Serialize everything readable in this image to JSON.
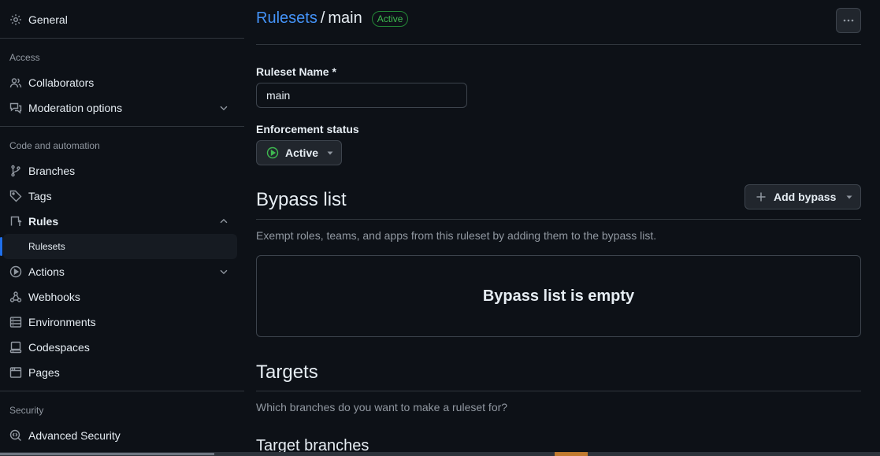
{
  "sidebar": {
    "general": "General",
    "access_label": "Access",
    "collaborators": "Collaborators",
    "moderation": "Moderation options",
    "code_label": "Code and automation",
    "branches": "Branches",
    "tags": "Tags",
    "rules": "Rules",
    "rulesets": "Rulesets",
    "actions": "Actions",
    "webhooks": "Webhooks",
    "environments": "Environments",
    "codespaces": "Codespaces",
    "pages": "Pages",
    "security_label": "Security",
    "advanced_security": "Advanced Security"
  },
  "header": {
    "breadcrumb_link": "Rulesets",
    "separator": "/",
    "current": "main",
    "status_badge": "Active"
  },
  "form": {
    "name_label": "Ruleset Name *",
    "name_value": "main",
    "enforcement_label": "Enforcement status",
    "enforcement_value": "Active"
  },
  "bypass": {
    "heading": "Bypass list",
    "add_button": "Add bypass",
    "description": "Exempt roles, teams, and apps from this ruleset by adding them to the bypass list.",
    "empty": "Bypass list is empty"
  },
  "targets": {
    "heading": "Targets",
    "description": "Which branches do you want to make a ruleset for?",
    "subheading": "Target branches"
  },
  "colors": {
    "background": "#0d1117",
    "link": "#4493f8",
    "success": "#3fb950",
    "border": "#30363d"
  }
}
